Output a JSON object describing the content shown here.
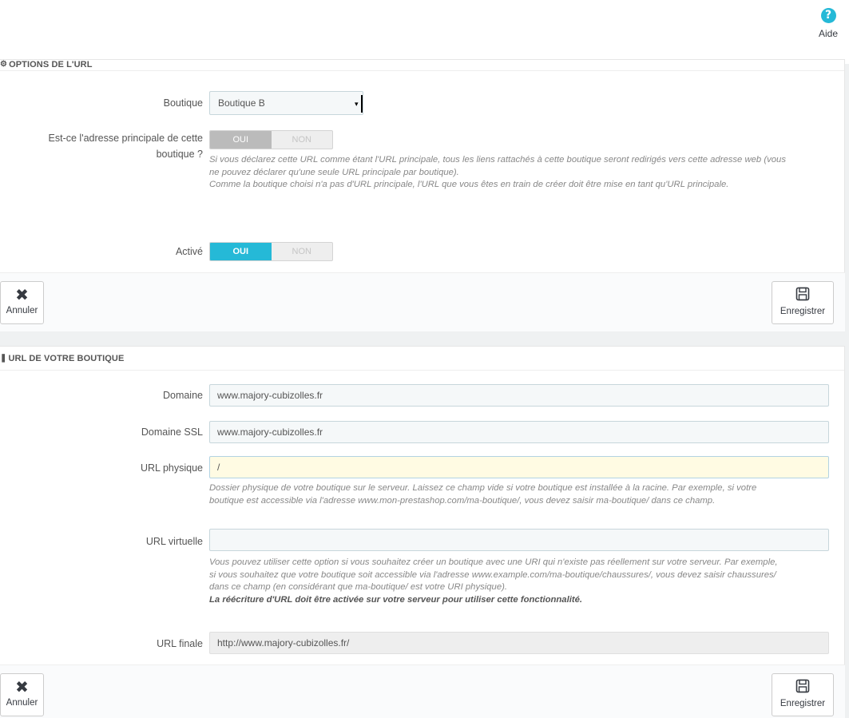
{
  "header": {
    "help_icon": "?",
    "help_label": "Aide"
  },
  "url_options": {
    "title": "OPTIONS DE L'URL",
    "shop_label": "Boutique",
    "shop_value": "Boutique B",
    "main_label_line1": "Est-ce l'adresse principale de cette",
    "main_label_line2": "boutique ?",
    "main_yes": "OUI",
    "main_no": "NON",
    "main_help_line1": "Si vous déclarez cette URL comme étant l'URL principale, tous les liens rattachés à cette boutique seront redirigés vers cette adresse web (vous",
    "main_help_line2": "ne pouvez déclarer qu'une seule URL principale par boutique).",
    "main_help_line3": "Comme la boutique choisi n'a pas d'URL principale, l'URL que vous êtes en train de créer doit être mise en tant qu'URL principale.",
    "active_label": "Activé",
    "active_yes": "OUI",
    "active_no": "NON",
    "cancel_label": "Annuler",
    "save_label": "Enregistrer"
  },
  "shop_url": {
    "title": "URL DE VOTRE BOUTIQUE",
    "domain_label": "Domaine",
    "domain_value": "www.majory-cubizolles.fr",
    "ssl_label": "Domaine SSL",
    "ssl_value": "www.majory-cubizolles.fr",
    "physical_label": "URL physique",
    "physical_value": "/",
    "physical_help_line1": "Dossier physique de votre boutique sur le serveur. Laissez ce champ vide si votre boutique est installée à la racine. Par exemple, si votre",
    "physical_help_line2": "boutique est accessible via l'adresse www.mon-prestashop.com/ma-boutique/, vous devez saisir ma-boutique/ dans ce champ.",
    "virtual_label": "URL virtuelle",
    "virtual_value": "",
    "virtual_help_line1": "Vous pouvez utiliser cette option si vous souhaitez créer un boutique avec une URI qui n'existe pas réellement sur votre serveur. Par exemple,",
    "virtual_help_line2": "si vous souhaitez que votre boutique soit accessible via l'adresse www.example.com/ma-boutique/chaussures/, vous devez saisir chaussures/",
    "virtual_help_line3": "dans ce champ (en considérant que ma-boutique/ est votre URI physique).",
    "virtual_help_bold": "La réécriture d'URL doit être activée sur votre serveur pour utiliser cette fonctionnalité.",
    "final_label": "URL finale",
    "final_value": "http://www.majory-cubizolles.fr/",
    "cancel_label": "Annuler",
    "save_label": "Enregistrer"
  },
  "colors": {
    "accent": "#25b9d7",
    "background": "#eff1f2"
  }
}
